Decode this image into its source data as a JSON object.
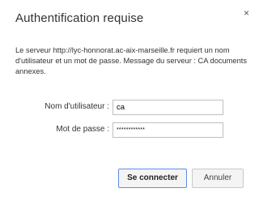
{
  "dialog": {
    "title": "Authentification requise",
    "close_glyph": "×",
    "message": "Le serveur http://lyc-honnorat.ac-aix-marseille.fr requiert un nom d'utilisateur et un mot de passe. Message du serveur : CA documents annexes.",
    "username_label": "Nom d'utilisateur :",
    "username_value": "ca",
    "password_label": "Mot de passe :",
    "password_value": "************",
    "connect_button": "Se connecter",
    "cancel_button": "Annuler"
  },
  "colors": {
    "primary_button_border": "#5a8ee8",
    "input_border": "#bfbfbf",
    "text": "#333333"
  }
}
